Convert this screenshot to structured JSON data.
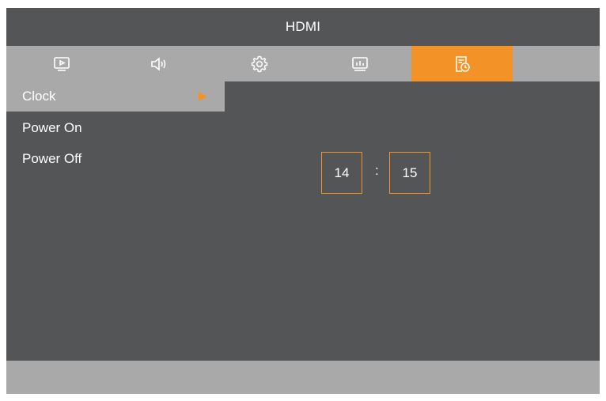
{
  "header": {
    "title": "HDMI"
  },
  "tabs": [
    {
      "icon": "play-icon",
      "active": false
    },
    {
      "icon": "speaker-icon",
      "active": false
    },
    {
      "icon": "gear-icon",
      "active": false
    },
    {
      "icon": "monitor-chart-icon",
      "active": false
    },
    {
      "icon": "timer-icon",
      "active": true
    }
  ],
  "menu": {
    "items": [
      {
        "label": "Clock",
        "selected": true
      },
      {
        "label": "Power On",
        "selected": false
      },
      {
        "label": "Power Off",
        "selected": false
      }
    ]
  },
  "clock": {
    "hour": "14",
    "separator": ":",
    "minute": "15"
  },
  "colors": {
    "accent": "#f39327",
    "panel": "#545556",
    "bar": "#a9a9aa",
    "text": "#ffffff"
  }
}
